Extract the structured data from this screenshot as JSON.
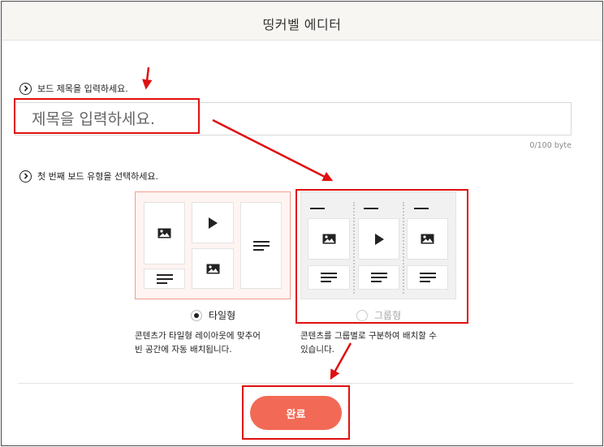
{
  "header": {
    "title": "띵커벨 에디터"
  },
  "board_title": {
    "label": "보드 제목을 입력하세요.",
    "placeholder": "제목을 입력하세요.",
    "value": "",
    "byte_count": "0/100 byte"
  },
  "board_type": {
    "label": "첫 번째 보드 유형을 선택하세요.",
    "options": [
      {
        "name": "타일형",
        "selected": true,
        "description": [
          "콘텐츠가 타일형 레이아웃에 맞추어",
          "빈 공간에 자동 배치됩니다."
        ]
      },
      {
        "name": "그룹형",
        "selected": false,
        "description": [
          "콘텐츠를 그룹별로 구분하여 배치할 수",
          "있습니다."
        ]
      }
    ]
  },
  "done_button": {
    "label": "완료"
  },
  "colors": {
    "accent": "#f26a55",
    "highlight": "#e01010",
    "header_bg": "#f7f6f2"
  },
  "icons": [
    "chevron-right-icon",
    "image-icon",
    "play-icon",
    "text-lines-icon",
    "radio-icon"
  ]
}
